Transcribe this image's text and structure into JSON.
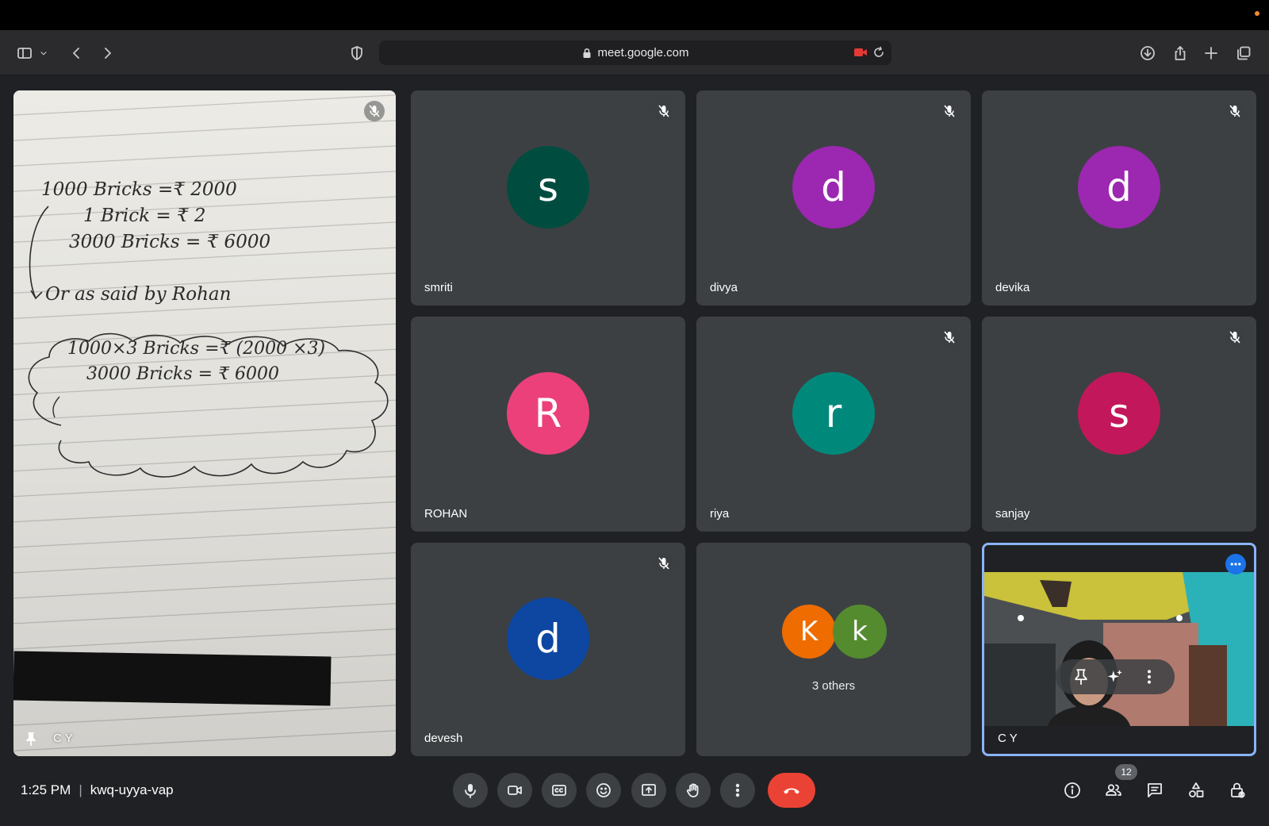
{
  "browser": {
    "url": "meet.google.com"
  },
  "presenter": {
    "name": "C Y",
    "notes": {
      "line1": "1000 Bricks  =₹ 2000",
      "line2": "1 Brick  =  ₹ 2",
      "line3": "3000 Bricks  =  ₹ 6000",
      "line4": "Or  as  said  by  Rohan",
      "line5": "1000×3  Bricks  =₹ (2000 ×3)",
      "line6": "3000  Bricks  =  ₹ 6000"
    }
  },
  "participants": [
    {
      "name": "smriti",
      "initial": "s",
      "color": "#004d40",
      "muted": true
    },
    {
      "name": "divya",
      "initial": "d",
      "color": "#9c27b0",
      "muted": true
    },
    {
      "name": "devika",
      "initial": "d",
      "color": "#9c27b0",
      "muted": true
    },
    {
      "name": "ROHAN",
      "initial": "R",
      "color": "#ec407a",
      "muted": false
    },
    {
      "name": "riya",
      "initial": "r",
      "color": "#00897b",
      "muted": true
    },
    {
      "name": "sanjay",
      "initial": "s",
      "color": "#c2185b",
      "muted": true
    },
    {
      "name": "devesh",
      "initial": "d",
      "color": "#0d47a1",
      "muted": true
    }
  ],
  "others": {
    "avatars": [
      {
        "initial": "K",
        "color": "#ef6c00"
      },
      {
        "initial": "k",
        "color": "#558b2f"
      }
    ],
    "label": "3 others"
  },
  "self": {
    "name": "C Y"
  },
  "meeting": {
    "time": "1:25 PM",
    "separator": "|",
    "code": "kwq-uyya-vap",
    "people_count": "12"
  },
  "colors": {
    "hangup": "#ea4335",
    "self_border": "#8ab4f8",
    "tile_bg": "#3c4043"
  }
}
